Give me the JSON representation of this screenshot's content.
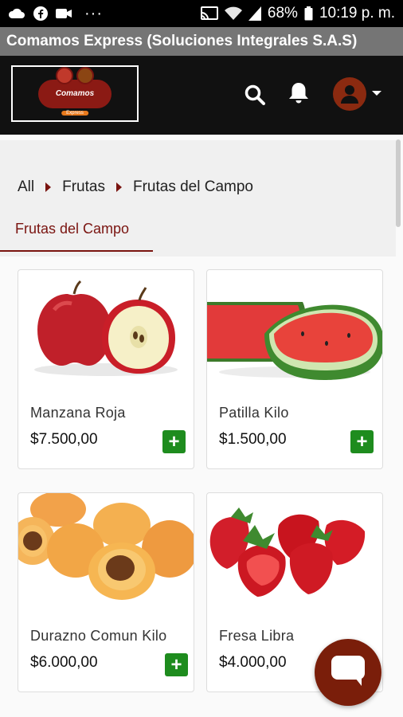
{
  "statusbar": {
    "battery": "68%",
    "time": "10:19 p. m.",
    "icons": [
      "cloud-icon",
      "facebook-icon",
      "video-icon",
      "more-icon",
      "cast-icon",
      "wifi-icon",
      "signal-icon",
      "battery-icon"
    ]
  },
  "app": {
    "title": "Comamos Express (Soluciones Integrales S.A.S)"
  },
  "header": {
    "logo_text": "Comamos",
    "logo_sub": "Express",
    "icons": [
      "search-icon",
      "bell-icon",
      "user-avatar-icon",
      "caret-down-icon"
    ]
  },
  "breadcrumb": {
    "items": [
      "All",
      "Frutas",
      "Frutas del Campo"
    ]
  },
  "tabs": {
    "active": "Frutas del Campo"
  },
  "products": [
    {
      "name": "Manzana Roja",
      "price": "$7.500,00",
      "add_label": "+"
    },
    {
      "name": "Patilla Kilo",
      "price": "$1.500,00",
      "add_label": "+"
    },
    {
      "name": "Durazno Comun Kilo",
      "price": "$6.000,00",
      "add_label": "+"
    },
    {
      "name": "Fresa Libra",
      "price": "$4.000,00",
      "add_label": "+"
    }
  ],
  "colors": {
    "brand": "#7a1410",
    "add_button": "#1e8c1e",
    "header_bg": "#111111",
    "titlebar_bg": "#757575"
  }
}
